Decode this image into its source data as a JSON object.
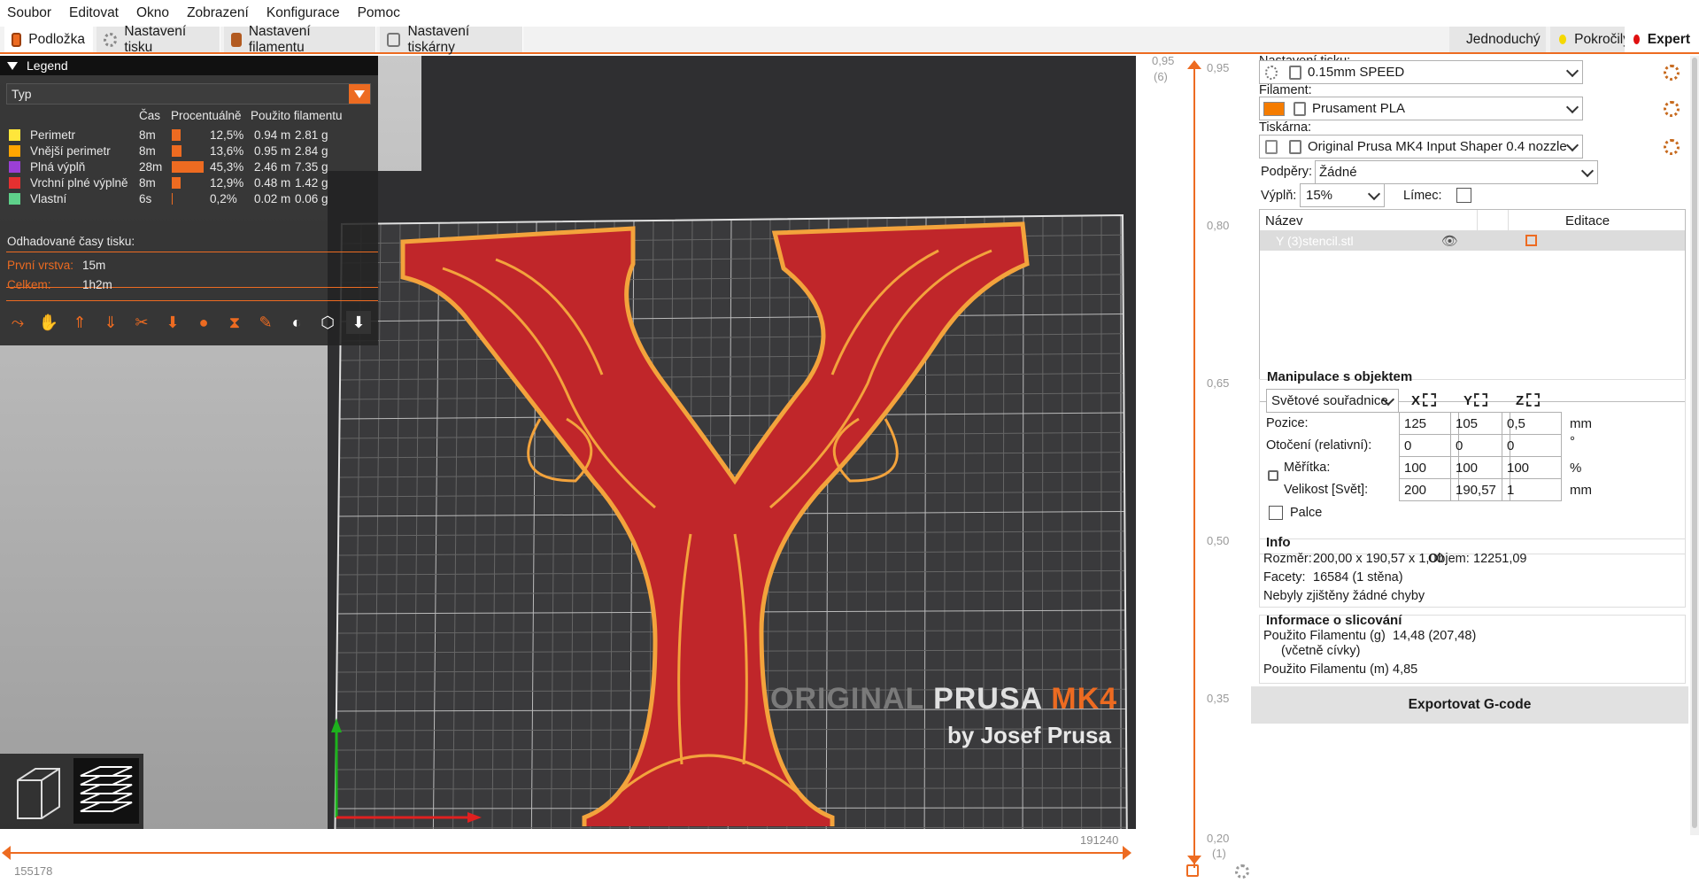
{
  "menu": [
    "Soubor",
    "Editovat",
    "Okno",
    "Zobrazení",
    "Konfigurace",
    "Pomoc"
  ],
  "tabs": {
    "plater": "Podložka",
    "print_settings": "Nastavení tisku",
    "filament_settings": "Nastavení filamentu",
    "printer_settings": "Nastavení tiskárny"
  },
  "modes": {
    "simple": "Jednoduchý",
    "advanced": "Pokročilý",
    "expert": "Expert",
    "colors": {
      "simple": "#2ecc40",
      "advanced": "#f5d800",
      "expert": "#e01010"
    }
  },
  "accent_color": "#ed6b21",
  "legend": {
    "title": "Legend",
    "type_select": "Typ",
    "headers": {
      "time": "Čas",
      "percent": "Procentuálně",
      "filament": "Použito filamentu"
    },
    "rows": [
      {
        "name": "Perimetr",
        "time": "8m",
        "percent": "12,5%",
        "length": "0.94 m",
        "weight": "2.81 g",
        "color": "#ffe63b",
        "share": 12.5
      },
      {
        "name": "Vnější perimetr",
        "time": "8m",
        "percent": "13,6%",
        "length": "0.95 m",
        "weight": "2.84 g",
        "color": "#ffa500",
        "share": 13.6
      },
      {
        "name": "Plná výplň",
        "time": "28m",
        "percent": "45,3%",
        "length": "2.46 m",
        "weight": "7.35 g",
        "color": "#9b3fd6",
        "share": 45.3
      },
      {
        "name": "Vrchní plné výplně",
        "time": "8m",
        "percent": "12,9%",
        "length": "0.48 m",
        "weight": "1.42 g",
        "color": "#e53030",
        "share": 12.9
      },
      {
        "name": "Vlastní",
        "time": "6s",
        "percent": "0,2%",
        "length": "0.02 m",
        "weight": "0.06 g",
        "color": "#5ed18a",
        "share": 0.2
      }
    ],
    "estimated_title": "Odhadované časy tisku:",
    "first_layer_label": "První vrstva:",
    "first_layer_value": "15m",
    "total_label": "Celkem:",
    "total_value": "1h2m"
  },
  "bed_logo": {
    "line1a": "ORIGINAL",
    "line1b": "PRUSA",
    "line1c": "MK4",
    "line2": "by Josef Prusa"
  },
  "hslider": {
    "left_value": "155178",
    "right_value": "191240"
  },
  "vslider": {
    "top_value": "0,95",
    "top_layer": "(6)",
    "bottom_value": "0,20",
    "bottom_layer": "(1)",
    "ticks": [
      "0,95",
      "0,80",
      "0,65",
      "0,50",
      "0,35"
    ]
  },
  "panel": {
    "print_settings_label": "Nastavení tisku:",
    "print_profile": "0.15mm SPEED",
    "filament_label": "Filament:",
    "filament_profile": "Prusament PLA",
    "filament_color": "#f57c00",
    "printer_label": "Tiskárna:",
    "printer_profile": "Original Prusa MK4 Input Shaper 0.4 nozzle",
    "supports_label": "Podpěry:",
    "supports_value": "Žádné",
    "infill_label": "Výplň:",
    "infill_value": "15%",
    "brim_label": "Límec:",
    "objects": {
      "col_name": "Název",
      "col_edit": "Editace",
      "items": [
        "Y (3)stencil.stl"
      ]
    },
    "manipulation": {
      "title": "Manipulace s objektem",
      "coord_system": "Světové souřadnice",
      "axes": [
        "X",
        "Y",
        "Z"
      ],
      "position_label": "Pozice:",
      "position": [
        "125",
        "105",
        "0,5"
      ],
      "position_unit": "mm",
      "rotation_label": "Otočení (relativní):",
      "rotation": [
        "0",
        "0",
        "0"
      ],
      "rotation_unit": "°",
      "scale_label": "Měřítka:",
      "scale": [
        "100",
        "100",
        "100"
      ],
      "scale_unit": "%",
      "size_label": "Velikost [Svět]:",
      "size": [
        "200",
        "190,57",
        "1"
      ],
      "size_unit": "mm",
      "inches_label": "Palce"
    },
    "info": {
      "title": "Info",
      "size_label": "Rozměr:",
      "size_value": "200,00 x 190,57 x 1,00",
      "volume_label": "Objem:",
      "volume_value": "12251,09",
      "facets_label": "Facety:",
      "facets_value": "16584 (1 stěna)",
      "errors": "Nebyly zjištěny žádné chyby"
    },
    "slice_info": {
      "title": "Informace o slicování",
      "used_g_label": "Použito Filamentu (g)",
      "used_g_sub": "(včetně cívky)",
      "used_g_value": "14,48 (207,48)",
      "used_m_label": "Použito Filamentu (m)",
      "used_m_value": "4,85"
    },
    "export_button": "Exportovat G-code"
  }
}
